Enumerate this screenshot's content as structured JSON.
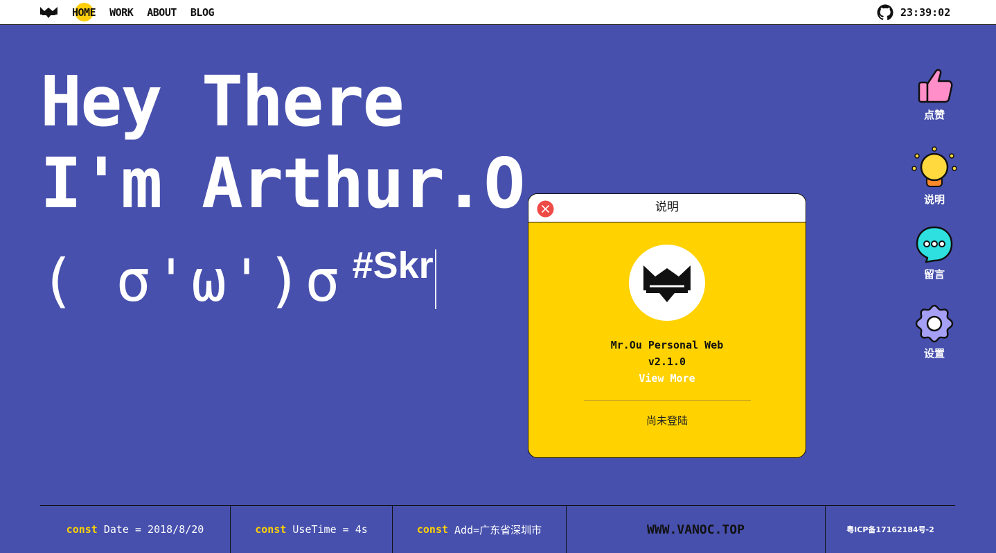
{
  "nav": {
    "items": [
      {
        "label": "HOME",
        "active": true
      },
      {
        "label": "WORK",
        "active": false
      },
      {
        "label": "ABOUT",
        "active": false
      },
      {
        "label": "BLOG",
        "active": false
      }
    ],
    "clock": "23:39:02",
    "logo_icon": "bat-logo-icon",
    "github_icon": "github-icon"
  },
  "hero": {
    "line1": "Hey There",
    "line2": "I'm Arthur.O",
    "kaomoji": "( σ'ω')σ",
    "tag": "#Skr"
  },
  "side_menu": [
    {
      "label": "点赞",
      "icon": "thumbs-up-icon",
      "color": "#ff8ec9"
    },
    {
      "label": "说明",
      "icon": "lightbulb-icon",
      "color": "#ffd93d"
    },
    {
      "label": "留言",
      "icon": "chat-bubble-icon",
      "color": "#2ee0e0"
    },
    {
      "label": "设置",
      "icon": "gear-icon",
      "color": "#a5a0f5"
    }
  ],
  "dialog": {
    "title": "说明",
    "name": "Mr.Ou Personal Web",
    "version": "v2.1.0",
    "view_more": "View More",
    "login_status": "尚未登陆"
  },
  "footer": {
    "date_kw": "const",
    "date_text": "Date = 2018/8/20",
    "time_kw": "const",
    "time_text": "UseTime = 4s",
    "addr_kw": "const",
    "addr_text": "Add=广东省深圳市",
    "site": "WWW.VANOC.TOP",
    "icp": "粤ICP备17162184号-2"
  },
  "colors": {
    "background": "#4750ad",
    "accent_yellow": "#ffd200",
    "white": "#ffffff"
  }
}
